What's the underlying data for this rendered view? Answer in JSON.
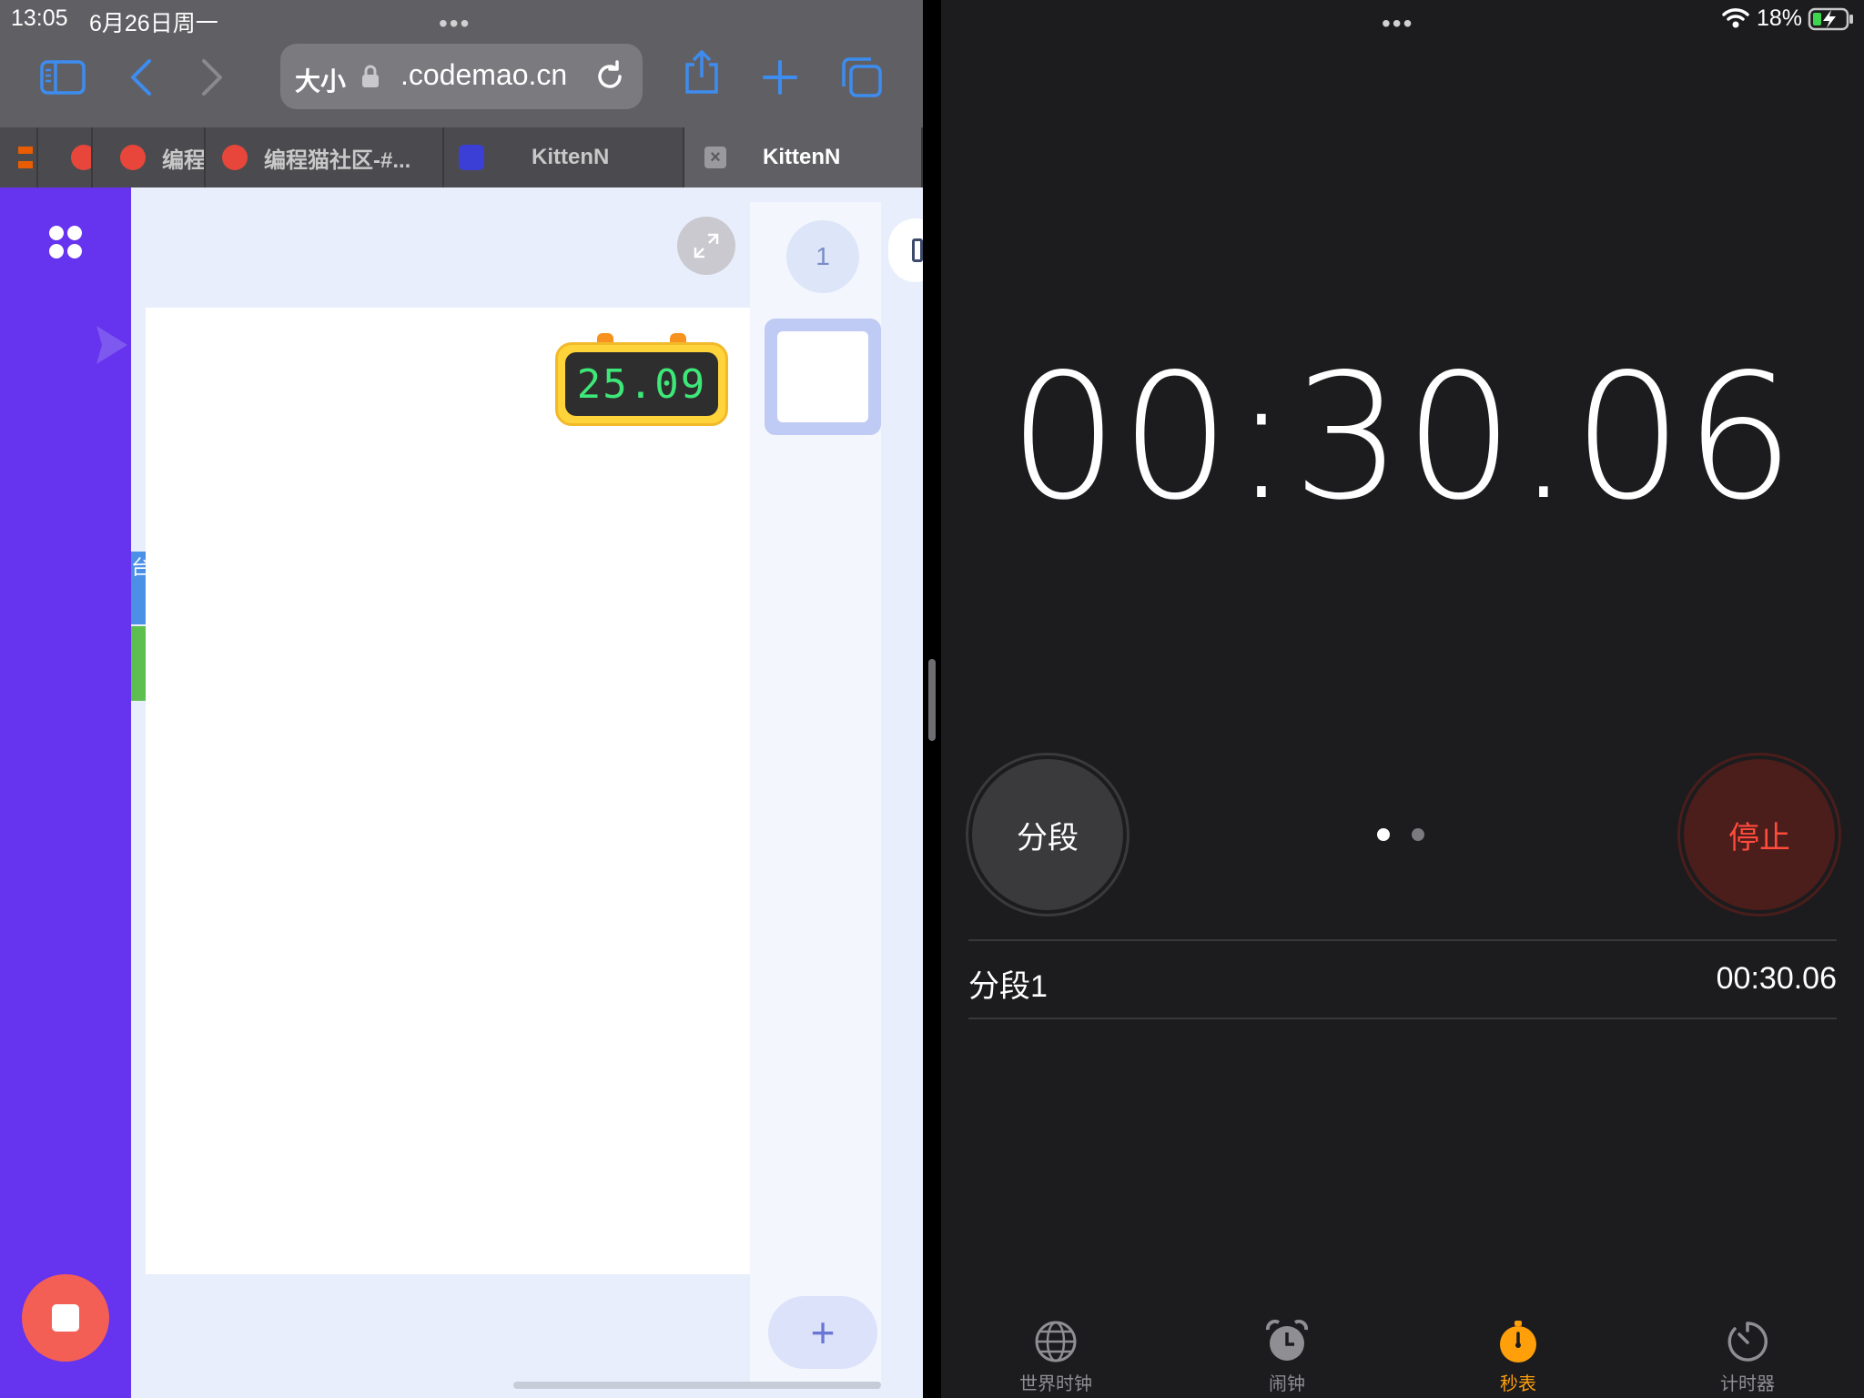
{
  "status_bar": {
    "time": "13:05",
    "date": "6月26日周一",
    "battery": "18%"
  },
  "safari": {
    "aa_label": "大小",
    "url": ".codemao.cn",
    "tabs": [
      {
        "label": ""
      },
      {
        "label": ""
      },
      {
        "label": "编程"
      },
      {
        "label": "编程猫社区-#..."
      },
      {
        "label": "KittenN"
      },
      {
        "label": "KittenN"
      }
    ]
  },
  "editor": {
    "scene_number": "1",
    "add_scene": "+",
    "timer_sprite_value": "25.09",
    "block_text": "台"
  },
  "stopwatch": {
    "time": "00:30.06",
    "lap_button": "分段",
    "stop_button": "停止",
    "laps": [
      {
        "name": "分段1",
        "time": "00:30.06"
      }
    ],
    "accent_color": "#ff9f0a",
    "stop_color": "#ff4b3c"
  },
  "clock_tabbar": {
    "items": [
      {
        "label": "世界时钟",
        "icon": "globe-icon",
        "active": false
      },
      {
        "label": "闹钟",
        "icon": "alarm-clock-icon",
        "active": false
      },
      {
        "label": "秒表",
        "icon": "stopwatch-icon",
        "active": true
      },
      {
        "label": "计时器",
        "icon": "timer-icon",
        "active": false
      }
    ]
  }
}
